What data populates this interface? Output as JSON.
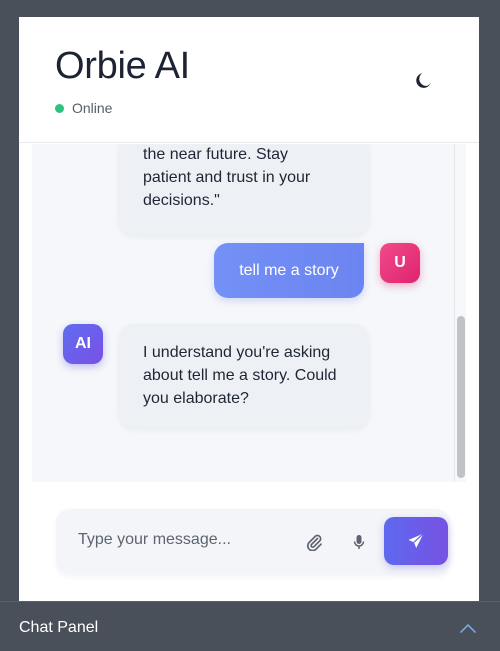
{
  "header": {
    "title": "Orbie AI",
    "status": "Online",
    "theme_icon": "moon-icon"
  },
  "messages": [
    {
      "role": "ai",
      "text": "the near future. Stay\npatient and trust in your\ndecisions.\""
    },
    {
      "role": "user",
      "avatar": "U",
      "text": "tell me a story"
    },
    {
      "role": "ai",
      "avatar": "AI",
      "text": "I understand you're asking\nabout tell me a story. Could\nyou elaborate?"
    }
  ],
  "composer": {
    "placeholder": "Type your message...",
    "attach_icon": "paperclip-icon",
    "mic_icon": "microphone-icon",
    "send_icon": "paper-plane-icon"
  },
  "footer": {
    "label": "Chat Panel",
    "toggle_icon": "chevron-up-icon"
  },
  "colors": {
    "accent": "#6c84f1",
    "online": "#2ec27e",
    "user_avatar": "#e0236f",
    "ai_avatar": "#6a5ee9"
  }
}
